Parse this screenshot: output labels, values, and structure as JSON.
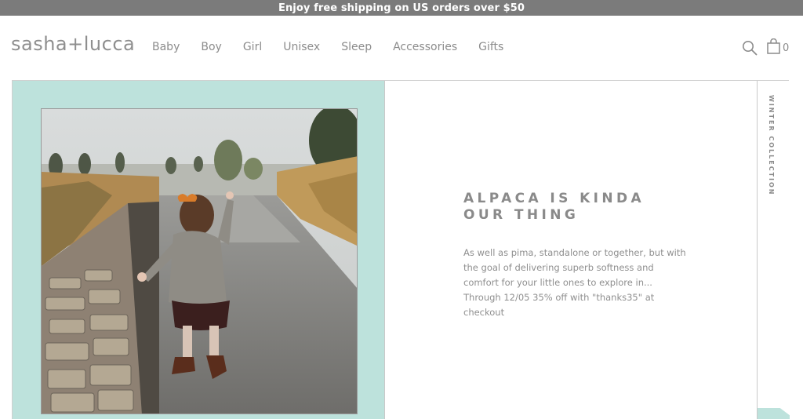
{
  "promo_bar": {
    "text": "Enjoy free shipping on US orders over $50"
  },
  "header": {
    "logo": "sasha+lucca",
    "nav": [
      "Baby",
      "Boy",
      "Girl",
      "Unisex",
      "Sleep",
      "Accessories",
      "Gifts"
    ],
    "search_icon": "search-icon",
    "cart_icon": "shopping-bag-icon",
    "cart_count": "0"
  },
  "hero": {
    "title": "ALPACA IS KINDA OUR THING",
    "body": "As well as pima, standalone or together, but with the goal of delivering superb softness and comfort for your little ones to explore in... Through 12/05 35% off with \"thanks35\" at checkout",
    "side_tab": "WINTER COLLECTION"
  },
  "colors": {
    "promo_bg": "#7b7b7b",
    "accent_mint": "#bde2dc",
    "text_gray": "#8c8c8c"
  }
}
